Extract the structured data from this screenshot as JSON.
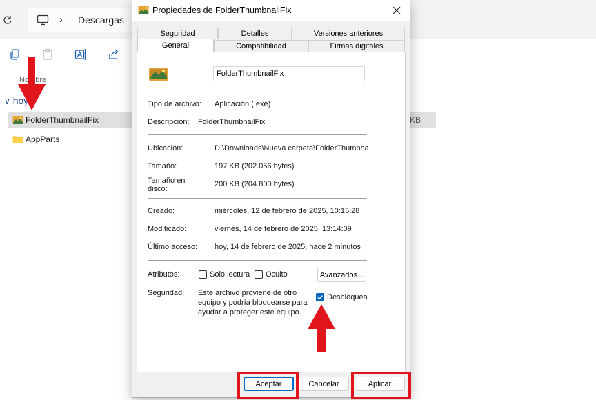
{
  "explorer": {
    "breadcrumb": "Descargas",
    "column_header": "Nombre",
    "group_label": "hoy",
    "files": [
      {
        "name": "FolderThumbnailFix",
        "icon": "app-exe-icon",
        "size_tail": "KB",
        "selected": true
      },
      {
        "name": "AppParts",
        "icon": "folder-icon",
        "size_tail": "",
        "selected": false
      }
    ]
  },
  "dialog": {
    "title": "Propiedades de FolderThumbnailFix",
    "tabs_row1": [
      "Seguridad",
      "Detalles",
      "Versiones anteriores"
    ],
    "tabs_row2": [
      "General",
      "Compatibilidad",
      "Firmas digitales"
    ],
    "active_tab": "General",
    "file_name": "FolderThumbnailFix",
    "fields": {
      "type_label": "Tipo de archivo:",
      "type_value": "Aplicación (.exe)",
      "desc_label": "Descripción:",
      "desc_value": "FolderThumbnailFix",
      "location_label": "Ubicación:",
      "location_value": "D:\\Downloads\\Nueva carpeta\\FolderThumbnailFix",
      "size_label": "Tamaño:",
      "size_value": "197 KB (202.056 bytes)",
      "disk_label_1": "Tamaño en",
      "disk_label_2": "disco:",
      "disk_value": "200 KB (204.800 bytes)",
      "created_label": "Creado:",
      "created_value": "miércoles, 12 de febrero de 2025, 10:15:28",
      "modified_label": "Modificado:",
      "modified_value": "viernes, 14 de febrero de 2025, 13:14:09",
      "accessed_label": "Último acceso:",
      "accessed_value": "hoy, 14 de febrero de 2025, hace 2 minutos"
    },
    "attributes": {
      "label": "Atributos:",
      "readonly_label": "Solo lectura",
      "readonly_checked": false,
      "hidden_label": "Oculto",
      "hidden_checked": false,
      "advanced_button": "Avanzados..."
    },
    "security": {
      "label": "Seguridad:",
      "text_line1": "Este archivo proviene de otro",
      "text_line2": "equipo y podría bloquearse para",
      "text_line3": "ayudar a proteger este equipo.",
      "unblock_label": "Desbloquear",
      "unblock_checked": true
    },
    "buttons": {
      "ok": "Aceptar",
      "cancel": "Cancelar",
      "apply": "Aplicar"
    }
  },
  "colors": {
    "accent": "#0067c0",
    "annotation_red": "#e0141c",
    "dialog_bg": "#f0f0f0"
  }
}
